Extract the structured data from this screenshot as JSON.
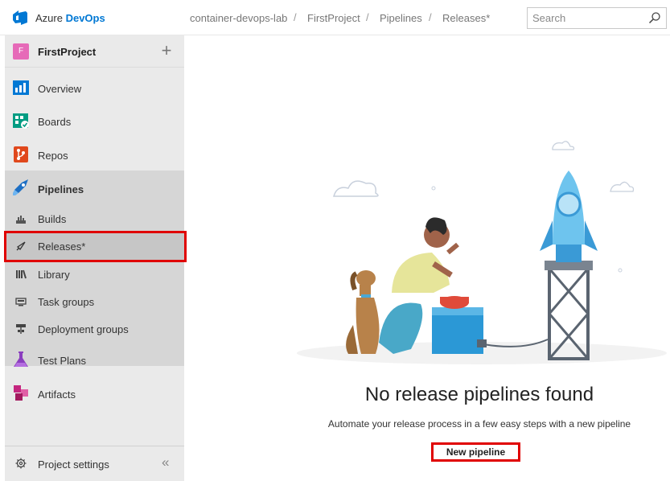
{
  "header": {
    "brand_prefix": "Azure ",
    "brand_suffix": "DevOps",
    "breadcrumb": [
      "container-devops-lab",
      "FirstProject",
      "Pipelines",
      "Releases*"
    ],
    "separator": "/",
    "search": {
      "placeholder": "Search",
      "value": ""
    }
  },
  "sidebar": {
    "project": {
      "initial": "F",
      "name": "FirstProject",
      "add": "+"
    },
    "items": [
      {
        "label": "Overview",
        "icon": "overview-icon"
      },
      {
        "label": "Boards",
        "icon": "boards-icon"
      },
      {
        "label": "Repos",
        "icon": "repos-icon"
      },
      {
        "label": "Pipelines",
        "icon": "pipelines-icon"
      },
      {
        "label": "Builds",
        "icon": "builds-icon"
      },
      {
        "label": "Releases*",
        "icon": "releases-icon"
      },
      {
        "label": "Library",
        "icon": "library-icon"
      },
      {
        "label": "Task groups",
        "icon": "task-groups-icon"
      },
      {
        "label": "Deployment groups",
        "icon": "deployment-groups-icon"
      },
      {
        "label": "Test Plans",
        "icon": "test-plans-icon"
      },
      {
        "label": "Artifacts",
        "icon": "artifacts-icon"
      }
    ],
    "settings_label": "Project settings",
    "collapse": "«"
  },
  "main": {
    "title": "No release pipelines found",
    "subtitle": "Automate your release process in a few easy steps with a new pipeline",
    "new_pipeline_label": "New pipeline"
  },
  "colors": {
    "accent": "#0078d4",
    "highlight_box": "#e00000",
    "project_badge": "#e66ab8"
  }
}
